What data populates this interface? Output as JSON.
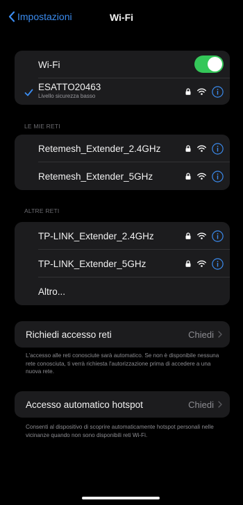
{
  "nav": {
    "back_label": "Impostazioni",
    "title": "Wi-Fi"
  },
  "wifi": {
    "label": "Wi-Fi",
    "enabled": true,
    "connected": {
      "name": "ESATTO20463",
      "detail": "Livello sicurezza basso"
    }
  },
  "my_networks": {
    "header": "LE MIE RETI",
    "items": [
      {
        "name": "Retemesh_Extender_2.4GHz"
      },
      {
        "name": "Retemesh_Extender_5GHz"
      }
    ]
  },
  "other_networks": {
    "header": "ALTRE RETI",
    "items": [
      {
        "name": "TP-LINK_Extender_2.4GHz"
      },
      {
        "name": "TP-LINK_Extender_5GHz"
      }
    ],
    "other_label": "Altro..."
  },
  "ask_join": {
    "label": "Richiedi accesso reti",
    "value": "Chiedi",
    "footer": "L'accesso alle reti conosciute sarà automatico. Se non è disponibile nessuna rete conosciuta, ti verrà richiesta l'autorizzazione prima di accedere a una nuova rete."
  },
  "auto_hotspot": {
    "label": "Accesso automatico hotspot",
    "value": "Chiedi",
    "footer": "Consenti al dispositivo di scoprire automaticamente hotspot personali nelle vicinanze quando non sono disponibili reti Wi-Fi."
  },
  "icons": {
    "back": "chevron-left-icon",
    "check": "checkmark-icon",
    "lock": "lock-icon",
    "wifi": "wifi-icon",
    "info": "info-icon",
    "disclosure": "chevron-right-icon"
  },
  "colors": {
    "accent": "#3b8cf0",
    "toggle_on": "#34c759",
    "background": "#000000",
    "cell": "#1c1c1e"
  }
}
